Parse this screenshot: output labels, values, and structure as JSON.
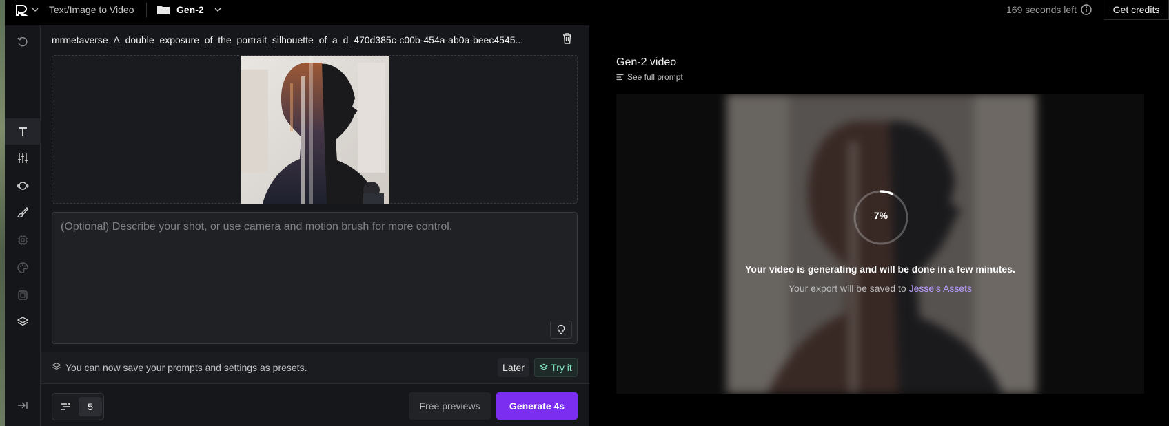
{
  "topbar": {
    "tool_title": "Text/Image to Video",
    "project_name": "Gen-2",
    "time_left": "169 seconds left",
    "credits_label": "Get credits"
  },
  "rail": {
    "items": [
      {
        "icon": "history-icon",
        "active": false
      },
      {
        "icon": "text-icon",
        "active": true
      },
      {
        "icon": "sliders-icon",
        "active": false
      },
      {
        "icon": "camera-motion-icon",
        "active": false
      },
      {
        "icon": "motion-brush-icon",
        "active": false
      },
      {
        "icon": "chip-icon",
        "active": false
      },
      {
        "icon": "palette-icon",
        "active": false
      },
      {
        "icon": "film-icon",
        "active": false
      },
      {
        "icon": "layers-icon",
        "active": false
      },
      {
        "icon": "collapse-icon",
        "active": false
      }
    ]
  },
  "editor": {
    "filename": "mrmetaverse_A_double_exposure_of_the_portrait_silhouette_of_a_d_470d385c-c00b-454a-ab0a-beec4545...",
    "prompt_placeholder": "(Optional) Describe your shot, or use camera and motion brush for more control.",
    "prompt_value": "",
    "preset_notice": "You can now save your prompts and settings as presets.",
    "later_label": "Later",
    "try_label": "Try it",
    "motion_value": "5",
    "free_previews_label": "Free previews",
    "generate_label": "Generate 4s"
  },
  "output": {
    "title": "Gen-2 video",
    "see_prompt_label": "See full prompt",
    "progress_percent": 7,
    "progress_label": "7%",
    "generating_message": "Your video is generating and will be done in a few minutes.",
    "save_prefix": "Your export will be saved to",
    "assets_link": "Jesse's Assets"
  },
  "colors": {
    "accent": "#7b2df0",
    "try_it": "#7ee6c0",
    "link": "#b89cff"
  }
}
